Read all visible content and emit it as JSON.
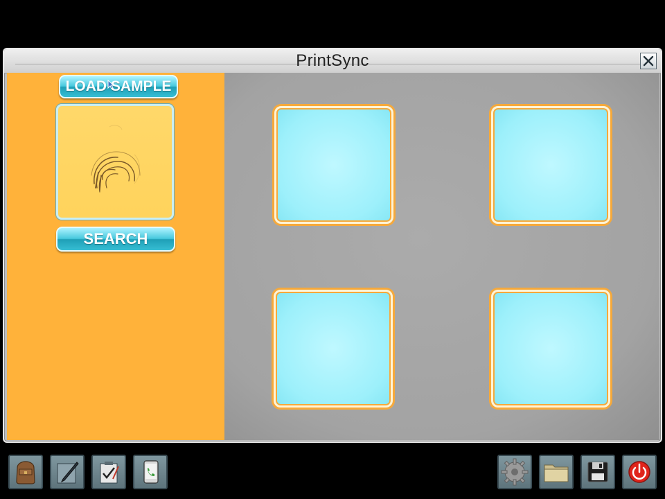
{
  "window": {
    "title": "PrintSync"
  },
  "left_panel": {
    "load_button_label": "LOAD SAMPLE",
    "search_button_label": "SEARCH"
  },
  "result_slots": [
    {
      "status": "empty"
    },
    {
      "status": "empty"
    },
    {
      "status": "empty"
    },
    {
      "status": "empty"
    }
  ],
  "dock": {
    "left": [
      "backpack-icon",
      "pen-notepad-icon",
      "checklist-icon",
      "phone-icon"
    ],
    "right": [
      "gear-icon",
      "folder-icon",
      "floppy-disk-icon",
      "power-icon"
    ]
  },
  "colors": {
    "left_panel": "#ffb23a",
    "button_cyan": "#46c8dd",
    "slot_fill": "#9df0fb",
    "slot_border": "#f6a93b",
    "power_red": "#e0241b"
  }
}
